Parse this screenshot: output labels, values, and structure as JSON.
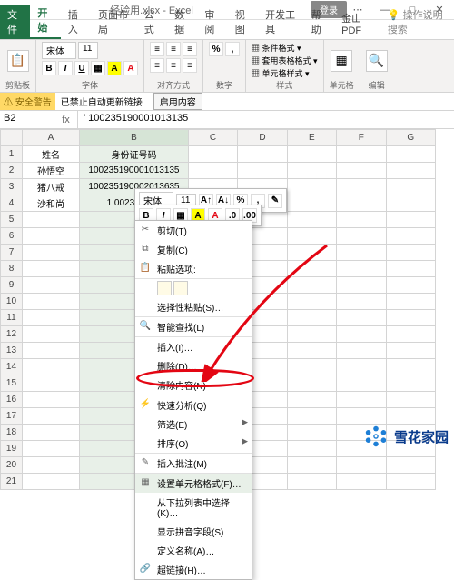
{
  "title": "经验用.xlsx - Excel",
  "login": "登录",
  "winbtns": {
    "min": "—",
    "restore": "□",
    "max": "▢",
    "close": "✕"
  },
  "tabs": {
    "file": "文件",
    "items": [
      "开始",
      "插入",
      "页面布局",
      "公式",
      "数据",
      "审阅",
      "视图",
      "开发工具",
      "帮助",
      "金山PDF"
    ],
    "right": "操作说明搜索"
  },
  "ribbon": {
    "clipboard": {
      "paste": "粘贴",
      "clip": "剪贴板"
    },
    "font": {
      "name": "宋体",
      "size": "11",
      "label": "字体",
      "b": "B",
      "i": "I",
      "u": "U"
    },
    "align": {
      "label": "对齐方式"
    },
    "number": {
      "label": "数字",
      "pct": "%",
      "comma": ","
    },
    "styles": {
      "cond": "条件格式",
      "tbl": "套用表格格式",
      "cell": "单元格样式",
      "label": "样式"
    },
    "cells": {
      "label": "单元格"
    },
    "editing": {
      "label": "编辑"
    }
  },
  "warn": {
    "tag": "安全警告",
    "msg": "已禁止自动更新链接",
    "btn": "启用内容"
  },
  "fx": {
    "cell": "B2",
    "sym": "fx",
    "val": "' 100235190001013135"
  },
  "cols": [
    "",
    "A",
    "B",
    "C",
    "D",
    "E",
    "F",
    "G"
  ],
  "rows": [
    1,
    2,
    3,
    4,
    5,
    6,
    7,
    8,
    9,
    10,
    11,
    12,
    13,
    14,
    15,
    16,
    17,
    18,
    19,
    20,
    21
  ],
  "dataA": [
    "姓名",
    "孙悟空",
    "猪八戒",
    "沙和尚"
  ],
  "dataB": [
    "身份证号码",
    "100235190001013135",
    "100235190002013635",
    "1.00235E+16"
  ],
  "mini": {
    "font": "宋体",
    "size": "11",
    "b": "B",
    "i": "I"
  },
  "ctx": [
    {
      "icon": "✂",
      "label": "剪切(T)"
    },
    {
      "icon": "⧉",
      "label": "复制(C)"
    },
    {
      "icon": "📋",
      "label": "粘贴选项:",
      "paste": true,
      "sep": true
    },
    {
      "label": "选择性粘贴(S)…",
      "sep": true
    },
    {
      "icon": "🔍",
      "label": "智能查找(L)",
      "sep": true
    },
    {
      "label": "插入(I)…"
    },
    {
      "label": "删除(D)…"
    },
    {
      "label": "清除内容(N)",
      "sep": true
    },
    {
      "icon": "⚡",
      "label": "快速分析(Q)"
    },
    {
      "label": "筛选(E)",
      "arrow": true
    },
    {
      "label": "排序(O)",
      "arrow": true,
      "sep": true
    },
    {
      "icon": "✎",
      "label": "插入批注(M)",
      "sep": true
    },
    {
      "icon": "▦",
      "label": "设置单元格格式(F)…",
      "hl": true
    },
    {
      "label": "从下拉列表中选择(K)…"
    },
    {
      "label": "显示拼音字段(S)"
    },
    {
      "label": "定义名称(A)…"
    },
    {
      "icon": "🔗",
      "label": "超链接(H)…"
    }
  ],
  "wm": "雪花家园"
}
